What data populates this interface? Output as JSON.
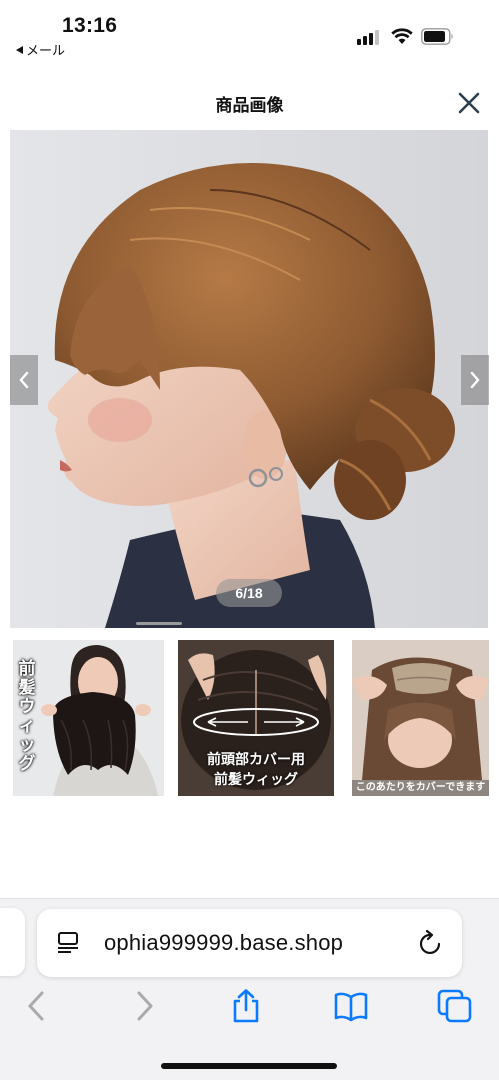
{
  "status_bar": {
    "time": "13:16",
    "back_app_label": "メール",
    "signal_bars": 3
  },
  "header": {
    "title": "商品画像",
    "close_icon": "close-icon"
  },
  "gallery": {
    "counter": "6/18",
    "prev_icon": "chevron-left-icon",
    "next_icon": "chevron-right-icon",
    "thumbnails": [
      {
        "caption_lines": [
          "前",
          "髪",
          "ウ",
          "ィ",
          "ッ",
          "グ"
        ]
      },
      {
        "caption_line1": "前頭部カバー用",
        "caption_line2": "前髪ウィッグ"
      },
      {
        "caption": "このあたりをカバーできます"
      }
    ]
  },
  "browser": {
    "url": "ophia999999.base.shop",
    "reader_icon": "reader-icon",
    "reload_icon": "reload-icon",
    "toolbar": [
      "back-icon",
      "forward-icon",
      "share-icon",
      "bookmarks-icon",
      "tabs-icon"
    ]
  },
  "colors": {
    "ios_blue": "#0a7aff",
    "disabled_gray": "#a9a9ae",
    "close_navy": "#2c3e50"
  }
}
